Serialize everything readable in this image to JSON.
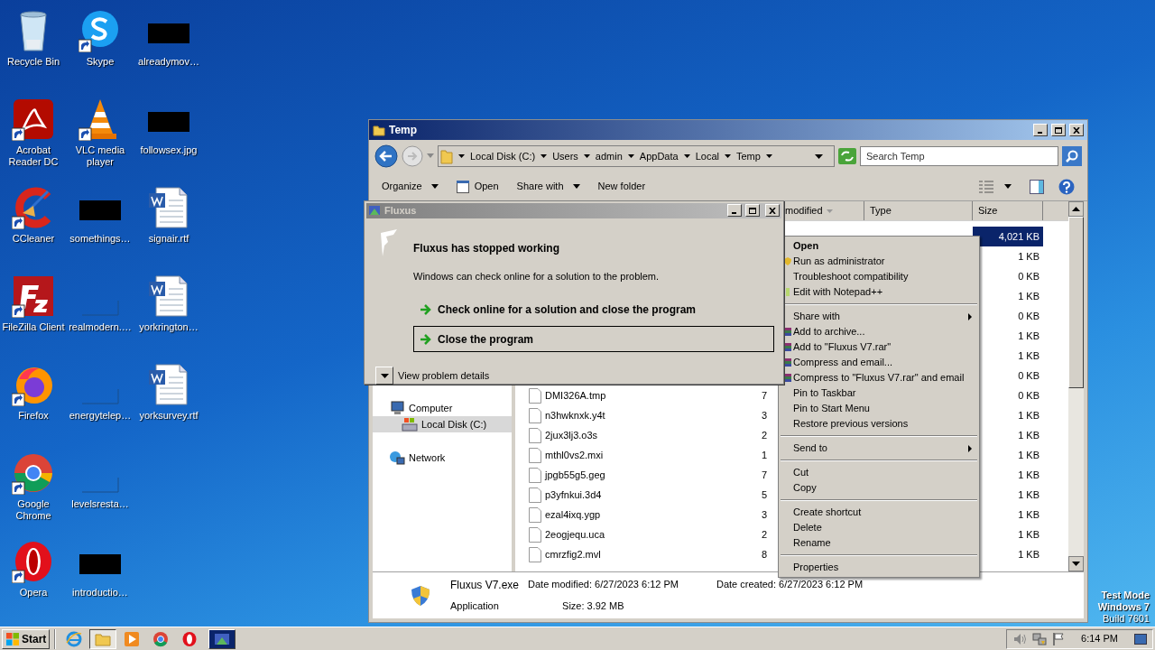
{
  "desktop_icons": [
    {
      "label": "Recycle Bin",
      "kind": "recycle",
      "shortcut": false
    },
    {
      "label": "Acrobat Reader DC",
      "kind": "acrobat",
      "shortcut": true
    },
    {
      "label": "CCleaner",
      "kind": "ccleaner",
      "shortcut": true
    },
    {
      "label": "FileZilla Client",
      "kind": "filezilla",
      "shortcut": true
    },
    {
      "label": "Firefox",
      "kind": "firefox",
      "shortcut": true
    },
    {
      "label": "Google Chrome",
      "kind": "chrome",
      "shortcut": true
    },
    {
      "label": "Opera",
      "kind": "opera",
      "shortcut": true
    },
    {
      "label": "Skype",
      "kind": "skype",
      "shortcut": true
    },
    {
      "label": "VLC media player",
      "kind": "vlc",
      "shortcut": true
    },
    {
      "label": "somethings…",
      "kind": "black",
      "shortcut": false
    },
    {
      "label": "realmodern.…",
      "kind": "blank",
      "shortcut": false
    },
    {
      "label": "energytelep…",
      "kind": "blank",
      "shortcut": false
    },
    {
      "label": "levelsresta…",
      "kind": "blank",
      "shortcut": false
    },
    {
      "label": "introductio…",
      "kind": "black",
      "shortcut": false
    },
    {
      "label": "alreadymov…",
      "kind": "black",
      "shortcut": false
    },
    {
      "label": "followsex.jpg",
      "kind": "black",
      "shortcut": false
    },
    {
      "label": "signair.rtf",
      "kind": "word",
      "shortcut": false
    },
    {
      "label": "yorkrington…",
      "kind": "word",
      "shortcut": false
    },
    {
      "label": "yorksurvey.rtf",
      "kind": "word",
      "shortcut": false
    }
  ],
  "explorer": {
    "title": "Temp",
    "breadcrumbs": [
      "Local Disk (C:)",
      "Users",
      "admin",
      "AppData",
      "Local",
      "Temp"
    ],
    "search": {
      "placeholder": "Search Temp"
    },
    "toolbar": [
      {
        "label": "Organize",
        "kind": "dropdown"
      },
      {
        "label": "Open",
        "kind": "icon"
      },
      {
        "label": "Share with",
        "kind": "dropdown"
      },
      {
        "label": "New folder",
        "kind": "plain"
      }
    ],
    "nav": [
      {
        "label": "Computer",
        "kind": "computer",
        "selected": false,
        "children": [
          {
            "label": "Local Disk (C:)",
            "kind": "drive",
            "selected": true
          }
        ]
      },
      {
        "label": "Network",
        "kind": "network",
        "selected": false
      }
    ],
    "columns": [
      {
        "label": "modified",
        "sorted": true
      },
      {
        "label": "Type",
        "sorted": false
      },
      {
        "label": "Size",
        "sorted": false
      }
    ],
    "rows": [
      {
        "size": "4,021 KB",
        "selected": true
      },
      {
        "size": "1 KB",
        "selected": false
      },
      {
        "size": "0 KB",
        "selected": false
      },
      {
        "size": "1 KB",
        "selected": false
      },
      {
        "size": "0 KB",
        "selected": false
      },
      {
        "size": "1 KB",
        "selected": false
      },
      {
        "size": "1 KB",
        "selected": false
      },
      {
        "size": "0 KB",
        "selected": false
      },
      {
        "name": "DMI326A.tmp",
        "column_2": "7",
        "size": "0 KB",
        "selected": false
      },
      {
        "name": "n3hwknxk.y4t",
        "column_2": "3",
        "size": "1 KB",
        "selected": false
      },
      {
        "name": "2jux3lj3.o3s",
        "column_2": "2",
        "size": "1 KB",
        "selected": false
      },
      {
        "name": "mthl0vs2.mxi",
        "column_2": "1",
        "size": "1 KB",
        "selected": false
      },
      {
        "name": "jpgb55g5.geg",
        "column_2": "7",
        "size": "1 KB",
        "selected": false
      },
      {
        "name": "p3yfnkui.3d4",
        "column_2": "5",
        "size": "1 KB",
        "selected": false
      },
      {
        "name": "ezal4ixq.ygp",
        "column_2": "3",
        "size": "1 KB",
        "selected": false
      },
      {
        "name": "2eogjequ.uca",
        "column_2": "2",
        "size": "1 KB",
        "selected": false
      },
      {
        "name": "cmrzfig2.mvl",
        "column_2": "8",
        "size": "1 KB",
        "selected": false
      }
    ],
    "details": {
      "name": "Fluxus V7.exe",
      "modified": "Date modified: 6/27/2023 6:12 PM",
      "created": "Date created: 6/27/2023 6:12 PM",
      "type": "Application",
      "size": "Size: 3.92 MB"
    }
  },
  "error_dialog": {
    "title": "Fluxus",
    "heading": "Fluxus has stopped working",
    "message": "Windows can check online for a solution to the problem.",
    "options": [
      {
        "label": "Check online for a solution and close the program",
        "selected": false
      },
      {
        "label": "Close the program",
        "selected": true
      }
    ],
    "details_toggle": "View problem details"
  },
  "context_menu": [
    {
      "kind": "item",
      "label": "Open",
      "bold": true
    },
    {
      "kind": "admin",
      "label": "Run as administrator"
    },
    {
      "kind": "item",
      "label": "Troubleshoot compatibility"
    },
    {
      "kind": "editor",
      "label": "Edit with Notepad++"
    },
    {
      "kind": "separator"
    },
    {
      "kind": "item",
      "label": "Share with",
      "submenu": true
    },
    {
      "kind": "archive",
      "label": "Add to archive..."
    },
    {
      "kind": "archive",
      "label": "Add to \"Fluxus V7.rar\""
    },
    {
      "kind": "archive",
      "label": "Compress and email..."
    },
    {
      "kind": "archive",
      "label": "Compress to \"Fluxus V7.rar\" and email"
    },
    {
      "kind": "item",
      "label": "Pin to Taskbar"
    },
    {
      "kind": "item",
      "label": "Pin to Start Menu"
    },
    {
      "kind": "item",
      "label": "Restore previous versions"
    },
    {
      "kind": "separator"
    },
    {
      "kind": "item",
      "label": "Send to",
      "submenu": true
    },
    {
      "kind": "separator"
    },
    {
      "kind": "item",
      "label": "Cut"
    },
    {
      "kind": "item",
      "label": "Copy"
    },
    {
      "kind": "separator"
    },
    {
      "kind": "item",
      "label": "Create shortcut"
    },
    {
      "kind": "item",
      "label": "Delete"
    },
    {
      "kind": "item",
      "label": "Rename"
    },
    {
      "kind": "separator"
    },
    {
      "kind": "item",
      "label": "Properties"
    }
  ],
  "system_text": [
    "Test Mode",
    "Windows 7",
    "Build 7601"
  ],
  "taskbar": {
    "start": "Start",
    "apps": [
      {
        "kind": "ie",
        "selected": false
      },
      {
        "kind": "explorer",
        "selected": true
      },
      {
        "kind": "media",
        "selected": false
      },
      {
        "kind": "chrome",
        "selected": false
      },
      {
        "kind": "opera",
        "selected": false
      }
    ],
    "tasks": [
      {
        "kind": "fluxus",
        "selected": false
      }
    ],
    "clock": "6:14 PM"
  }
}
